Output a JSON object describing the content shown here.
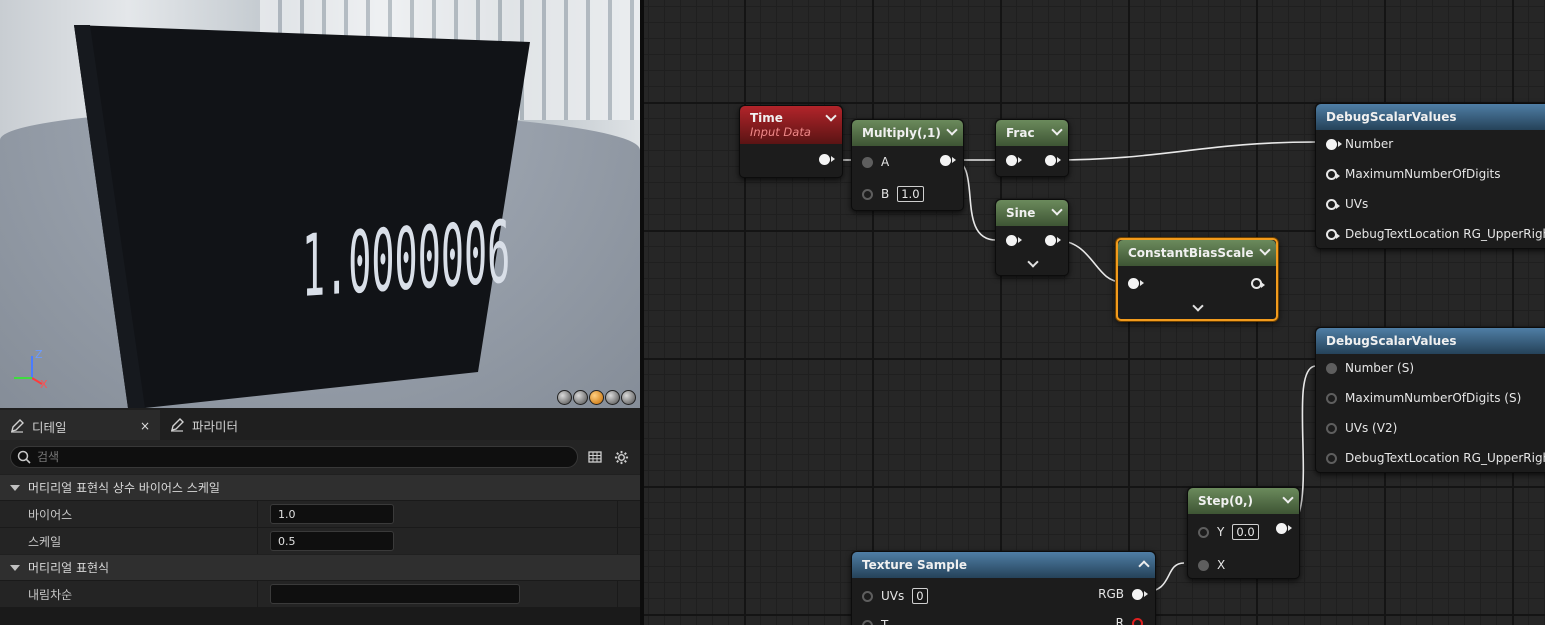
{
  "viewport": {
    "display_text": "1.0000006",
    "axis": {
      "z": "Z",
      "x": "X"
    },
    "view_modes": [
      "lit",
      "unlit",
      "sphere",
      "plane",
      "cube"
    ]
  },
  "details": {
    "tabs": [
      {
        "label": "디테일",
        "close": "×"
      },
      {
        "label": "파라미터"
      }
    ],
    "search_placeholder": "검색",
    "sections": [
      {
        "title": "머티리얼 표현식 상수 바이어스 스케일",
        "props": [
          {
            "label": "바이어스",
            "value": "1.0"
          },
          {
            "label": "스케일",
            "value": "0.5"
          }
        ]
      },
      {
        "title": "머티리얼 표현식",
        "props": [
          {
            "label": "내림차순",
            "value": ""
          }
        ]
      }
    ]
  },
  "graph": {
    "nodes": {
      "time": {
        "title": "Time",
        "subtitle": "Input Data"
      },
      "multiply": {
        "title": "Multiply(,1)",
        "pin_a": "A",
        "pin_b": "B",
        "b_value": "1.0"
      },
      "frac": {
        "title": "Frac"
      },
      "sine": {
        "title": "Sine"
      },
      "cbs": {
        "title": "ConstantBiasScale"
      },
      "debug1": {
        "title": "DebugScalarValues",
        "pins": [
          "Number",
          "MaximumNumberOfDigits",
          "UVs",
          "DebugTextLocation RG_UpperRight BA"
        ]
      },
      "debug2": {
        "title": "DebugScalarValues",
        "pins": [
          "Number (S)",
          "MaximumNumberOfDigits (S)",
          "UVs (V2)",
          "DebugTextLocation RG_UpperRight BA"
        ]
      },
      "step": {
        "title": "Step(0,)",
        "pin_y": "Y",
        "y_value": "0.0",
        "pin_x": "X"
      },
      "texture": {
        "title": "Texture Sample",
        "pin_uvs": "UVs",
        "uvs_value": "0",
        "pin_rgb": "RGB",
        "pin_t": "T",
        "pin_r": "R"
      }
    }
  },
  "colors": {
    "accent_selected": "#f29b1d",
    "math_header": "#5a7a4c",
    "input_header": "#a82026",
    "function_header": "#3d6a8f"
  }
}
